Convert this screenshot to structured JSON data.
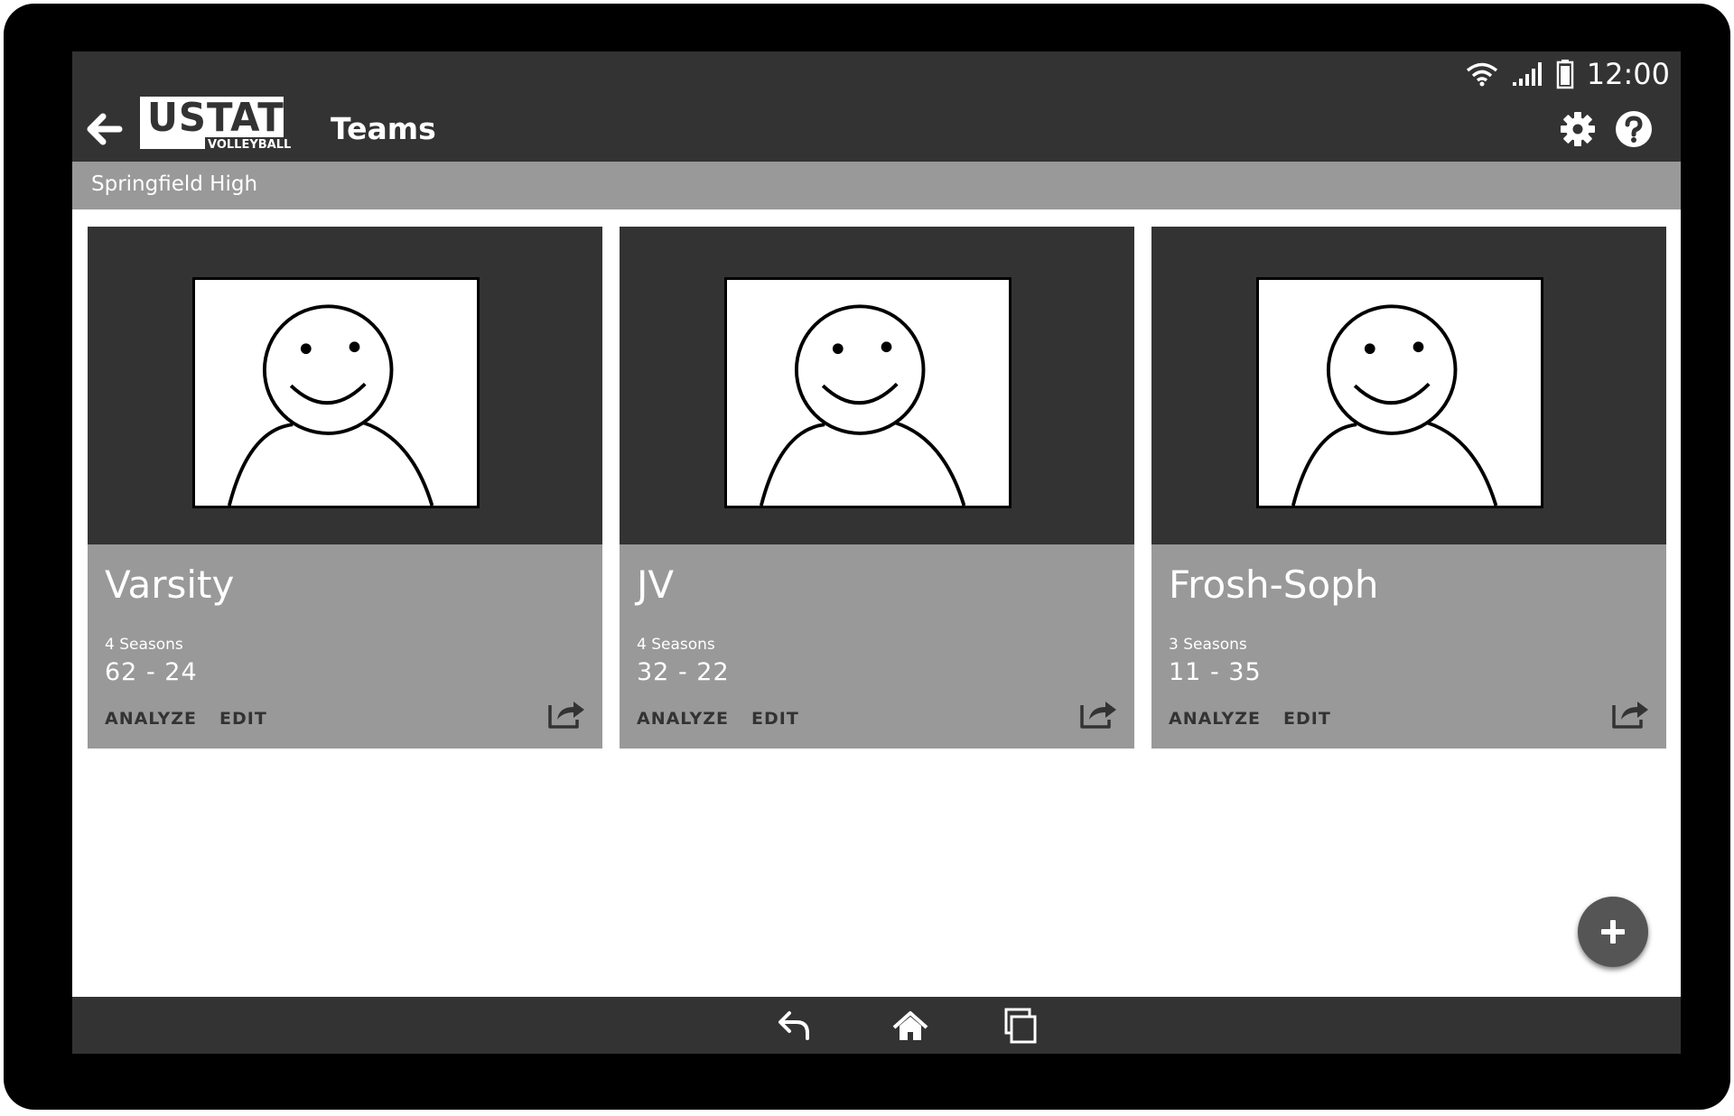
{
  "status_bar": {
    "time": "12:00",
    "icons": [
      "wifi-icon",
      "signal-icon",
      "battery-icon"
    ]
  },
  "app_bar": {
    "logo_text": "USTAT",
    "logo_subtext": "VOLLEYBALL",
    "title": "Teams",
    "icons": [
      "back-arrow-icon",
      "gear-icon",
      "help-icon"
    ]
  },
  "subheader": {
    "school": "Springfield High"
  },
  "teams": [
    {
      "name": "Varsity",
      "seasons": "4 Seasons",
      "record": "62 - 24",
      "analyze_label": "ANALYZE",
      "edit_label": "EDIT"
    },
    {
      "name": "JV",
      "seasons": "4 Seasons",
      "record": "32 - 22",
      "analyze_label": "ANALYZE",
      "edit_label": "EDIT"
    },
    {
      "name": "Frosh-Soph",
      "seasons": "3 Seasons",
      "record": "11 - 35",
      "analyze_label": "ANALYZE",
      "edit_label": "EDIT"
    }
  ],
  "fab": {
    "icon": "plus-icon"
  },
  "nav_bar": {
    "icons": [
      "nav-back-icon",
      "home-icon",
      "recent-apps-icon"
    ]
  },
  "colors": {
    "dark": "#333333",
    "medium": "#999999",
    "fab": "#555555",
    "bezel": "#000000"
  }
}
